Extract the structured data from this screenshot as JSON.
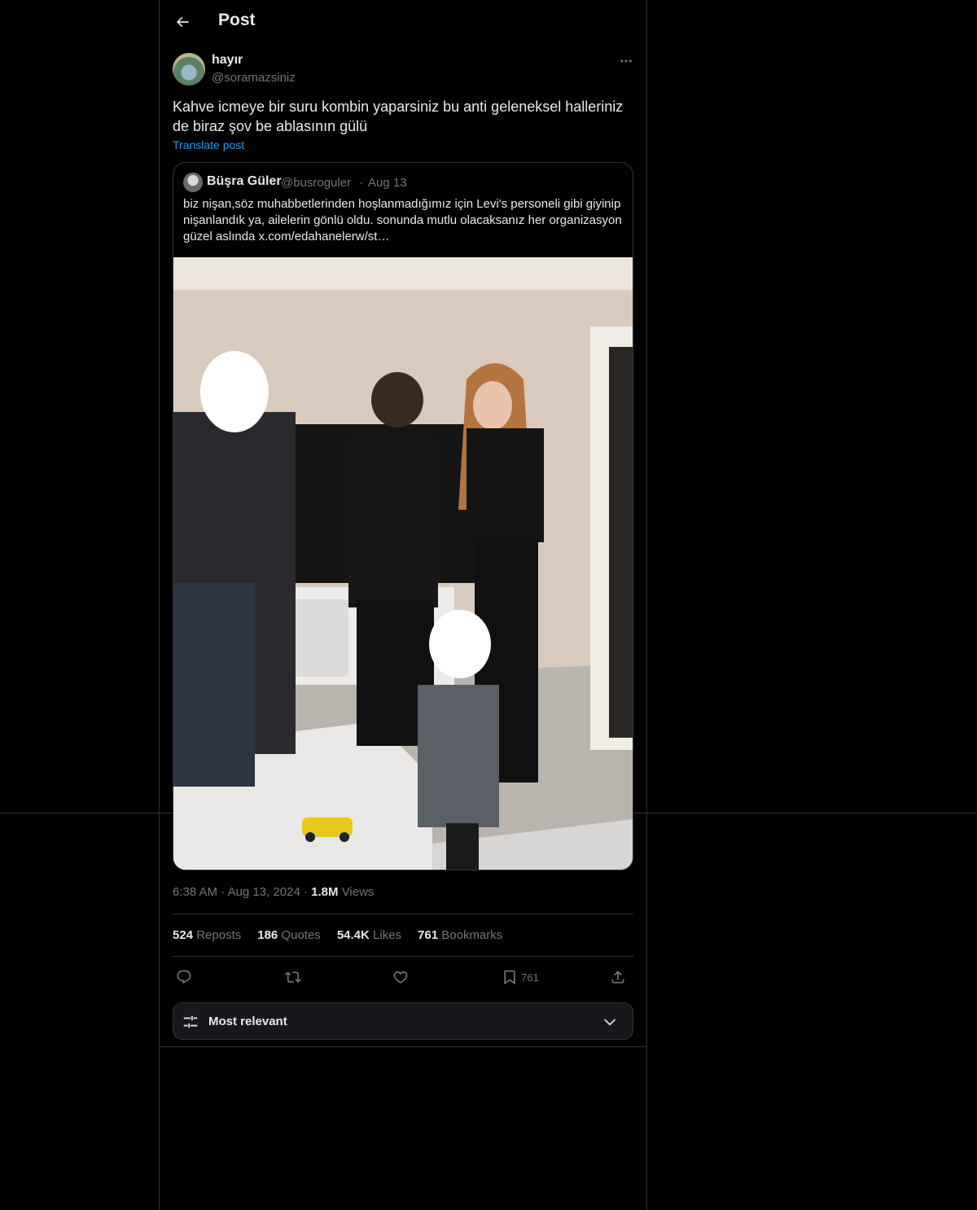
{
  "header": {
    "title": "Post"
  },
  "post": {
    "author_name": "hayır",
    "author_handle": "@soramazsiniz",
    "text": "Kahve icmeye bir suru kombin yaparsiniz bu anti geleneksel halleriniz de biraz şov be ablasının gülü",
    "translate_label": "Translate post",
    "time": "6:38 AM",
    "date": "Aug 13, 2024",
    "views_count": "1.8M",
    "views_label": "Views"
  },
  "quote": {
    "author_name": "Büşra Güler",
    "author_handle": "@busroguler",
    "date": "Aug 13",
    "text": "biz nişan,söz muhabbetlerinden hoşlanmadığımız için Levi's personeli gibi giyinip nişanlandık ya, ailelerin gönlü oldu. sonunda mutlu olacaksanız her organizasyon güzel aslında  x.com/edahanelerw/st…"
  },
  "stats": {
    "reposts_count": "524",
    "reposts_label": "Reposts",
    "quotes_count": "186",
    "quotes_label": "Quotes",
    "likes_count": "54.4K",
    "likes_label": "Likes",
    "bookmarks_count": "761",
    "bookmarks_label": "Bookmarks"
  },
  "actions": {
    "reply_icon": "reply-icon",
    "repost_icon": "repost-icon",
    "like_icon": "heart-icon",
    "bookmark_icon": "bookmark-icon",
    "bookmark_count": "761",
    "share_icon": "share-icon"
  },
  "sort": {
    "label": "Most relevant"
  },
  "colors": {
    "background": "#000000",
    "text": "#e7e9ea",
    "muted": "#71767b",
    "link": "#1d9bf0",
    "border": "#2f3336"
  }
}
